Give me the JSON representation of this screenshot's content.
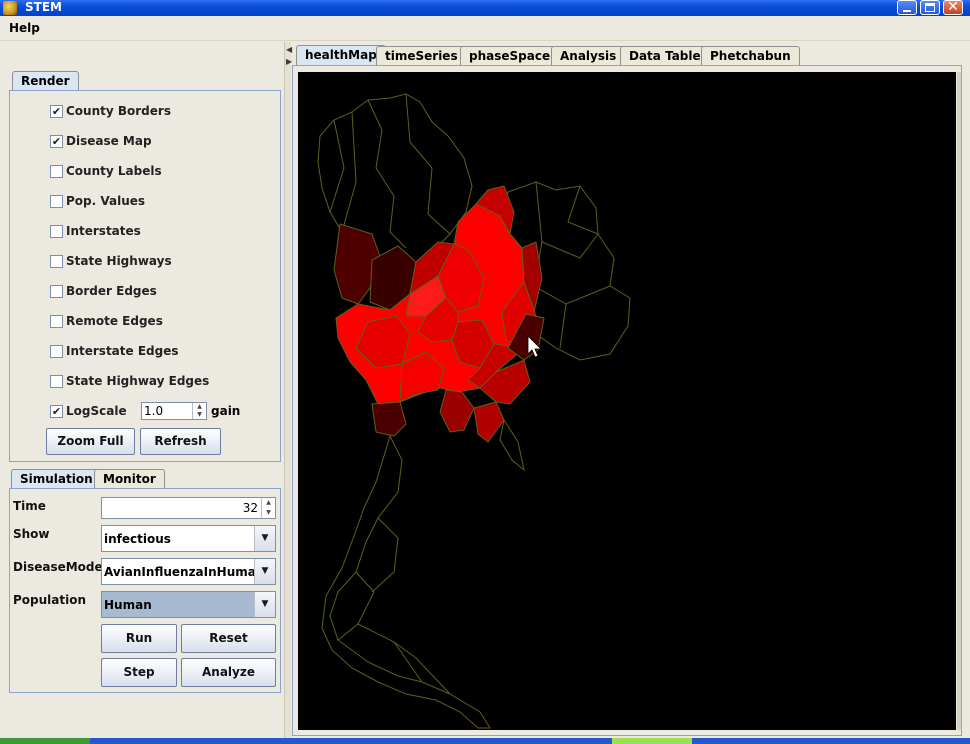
{
  "window": {
    "title": "STEM"
  },
  "menu": {
    "help_label": "Help"
  },
  "render": {
    "tab_label": "Render",
    "checkboxes": [
      {
        "label": "County Borders",
        "checked": true
      },
      {
        "label": "Disease Map",
        "checked": true
      },
      {
        "label": "County Labels",
        "checked": false
      },
      {
        "label": "Pop. Values",
        "checked": false
      },
      {
        "label": "Interstates",
        "checked": false
      },
      {
        "label": "State Highways",
        "checked": false
      },
      {
        "label": "Border Edges",
        "checked": false
      },
      {
        "label": "Remote Edges",
        "checked": false
      },
      {
        "label": "Interstate Edges",
        "checked": false
      },
      {
        "label": "State Highway Edges",
        "checked": false
      },
      {
        "label": "LogScale",
        "checked": true
      }
    ],
    "gain_value": "1.0",
    "gain_label": "gain",
    "zoom_full_label": "Zoom Full",
    "refresh_label": "Refresh"
  },
  "simulation": {
    "tab_simulation": "Simulation",
    "tab_monitor": "Monitor",
    "time_label": "Time",
    "time_value": "32",
    "show_label": "Show",
    "show_value": "infectious",
    "disease_model_label": "DiseaseModel",
    "disease_model_value": "AvianInfluenzaInHumans",
    "population_label": "Population",
    "population_value": "Human",
    "run_label": "Run",
    "reset_label": "Reset",
    "step_label": "Step",
    "analyze_label": "Analyze"
  },
  "tabs": [
    {
      "label": "healthMap",
      "active": true
    },
    {
      "label": "timeSeries",
      "active": false
    },
    {
      "label": "phaseSpace",
      "active": false
    },
    {
      "label": "Analysis",
      "active": false
    },
    {
      "label": "Data Table",
      "active": false
    },
    {
      "label": "Phetchabun",
      "active": false
    }
  ],
  "map": {
    "background": "#000000",
    "border_color": "#6b6b1e",
    "infection_colors": [
      "#ff0000",
      "#e00000",
      "#b80000",
      "#8a0000",
      "#5e0000",
      "#3a0000"
    ]
  }
}
